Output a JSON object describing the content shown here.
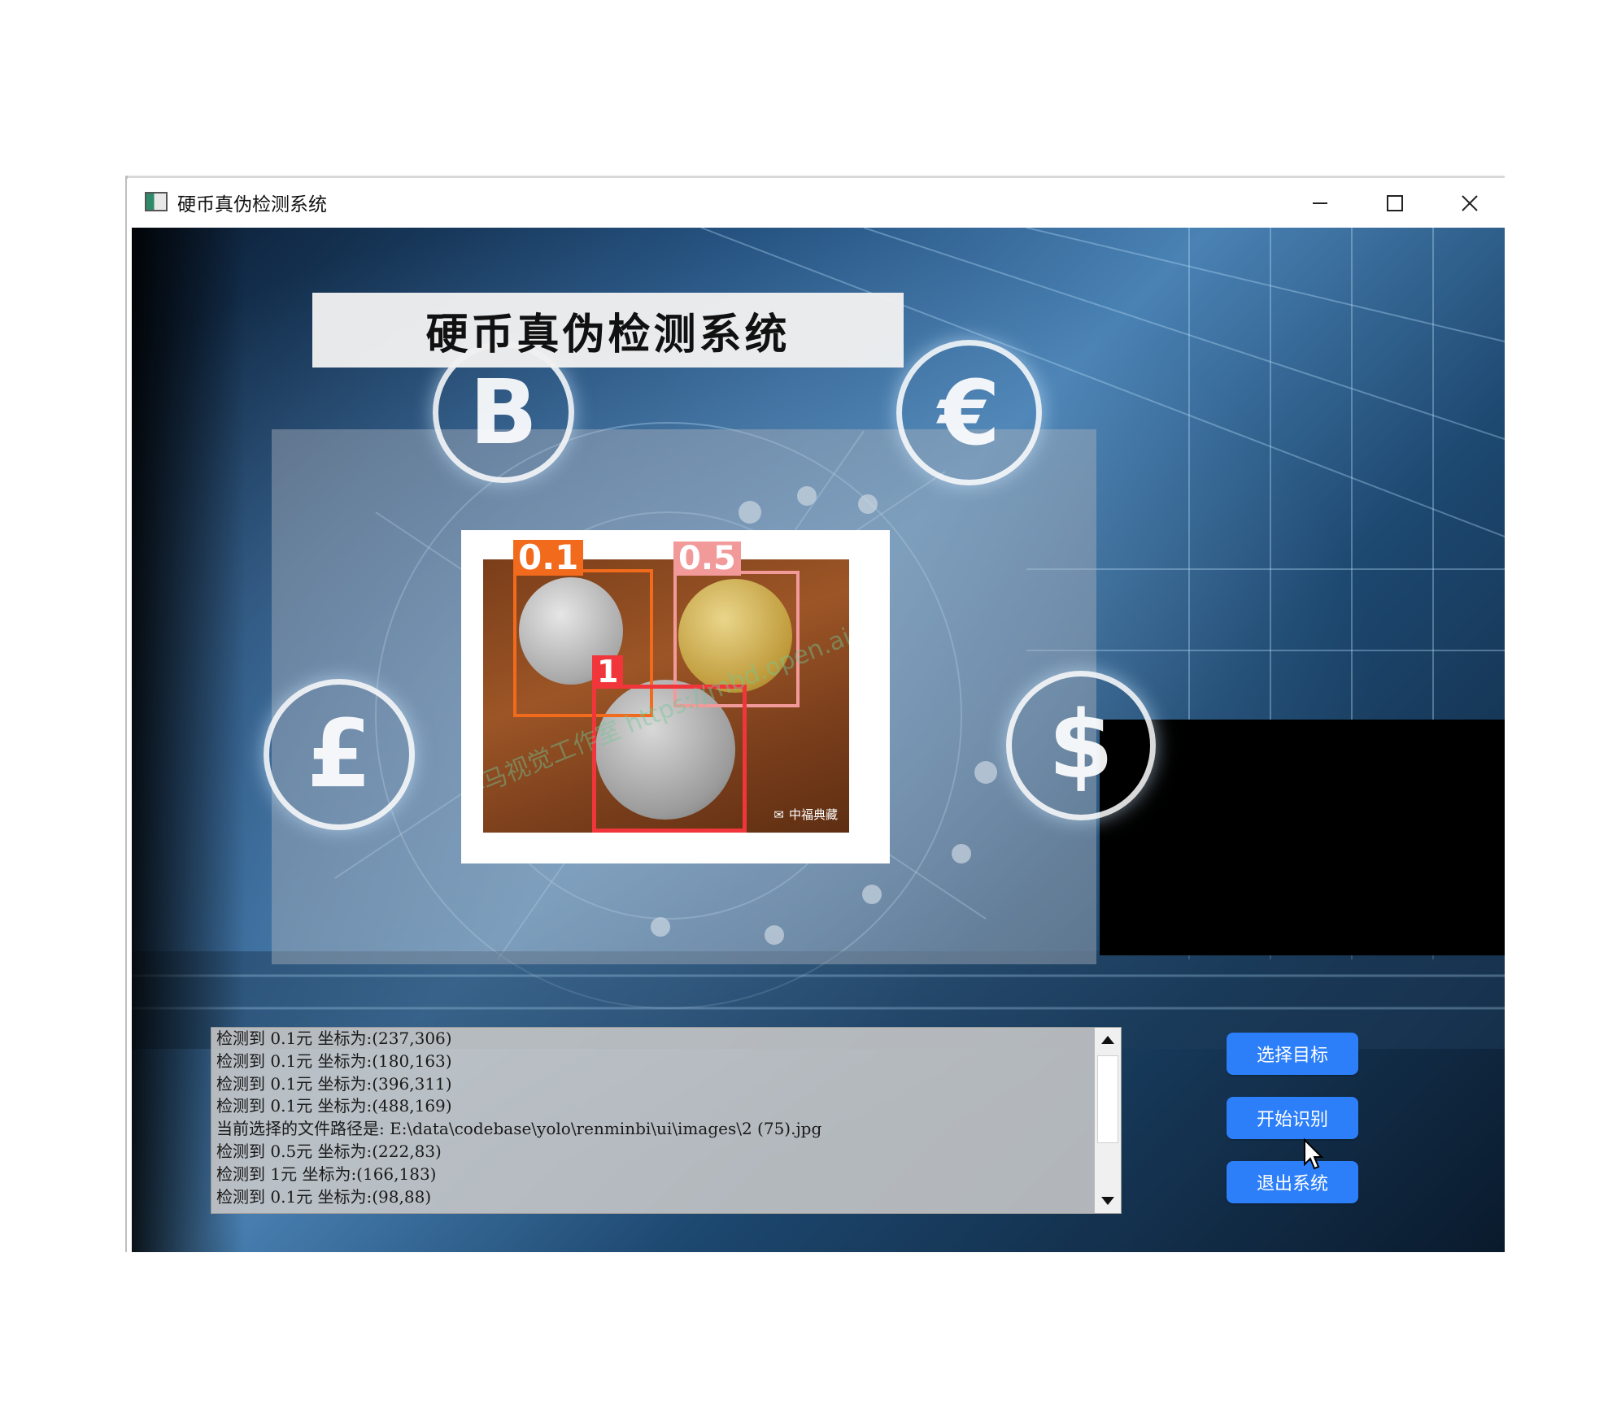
{
  "window": {
    "title": "硬币真伪检测系统",
    "controls": [
      "minimize",
      "maximize",
      "close"
    ]
  },
  "header": {
    "title": "硬币真伪检测系统"
  },
  "background_symbols": {
    "bitcoin": "B",
    "euro": "€",
    "pound": "£",
    "dollar": "$"
  },
  "detection_image": {
    "detections": [
      {
        "label": "0.1",
        "color": "#f26a1c"
      },
      {
        "label": "0.5",
        "color": "#f29a9a"
      },
      {
        "label": "1",
        "color": "#f0363a"
      }
    ],
    "watermark": "群马视觉工作室 https://mbd.open.ai/work",
    "brand": "中福典藏"
  },
  "log": {
    "lines": [
      "检测到 0.1元 坐标为:(237,306)",
      "检测到 0.1元 坐标为:(180,163)",
      "检测到 0.1元 坐标为:(396,311)",
      "检测到 0.1元 坐标为:(488,169)",
      "当前选择的文件路径是: E:\\data\\codebase\\yolo\\renminbi\\ui\\images\\2 (75).jpg",
      "检测到 0.5元 坐标为:(222,83)",
      "检测到 1元 坐标为:(166,183)",
      "检测到 0.1元 坐标为:(98,88)"
    ]
  },
  "buttons": {
    "select_target": "选择目标",
    "start_detect": "开始识别",
    "exit_system": "退出系统"
  },
  "colors": {
    "button": "#2d7ff9",
    "accent_orange": "#f26a1c",
    "accent_pink": "#f29a9a",
    "accent_red": "#f0363a"
  }
}
